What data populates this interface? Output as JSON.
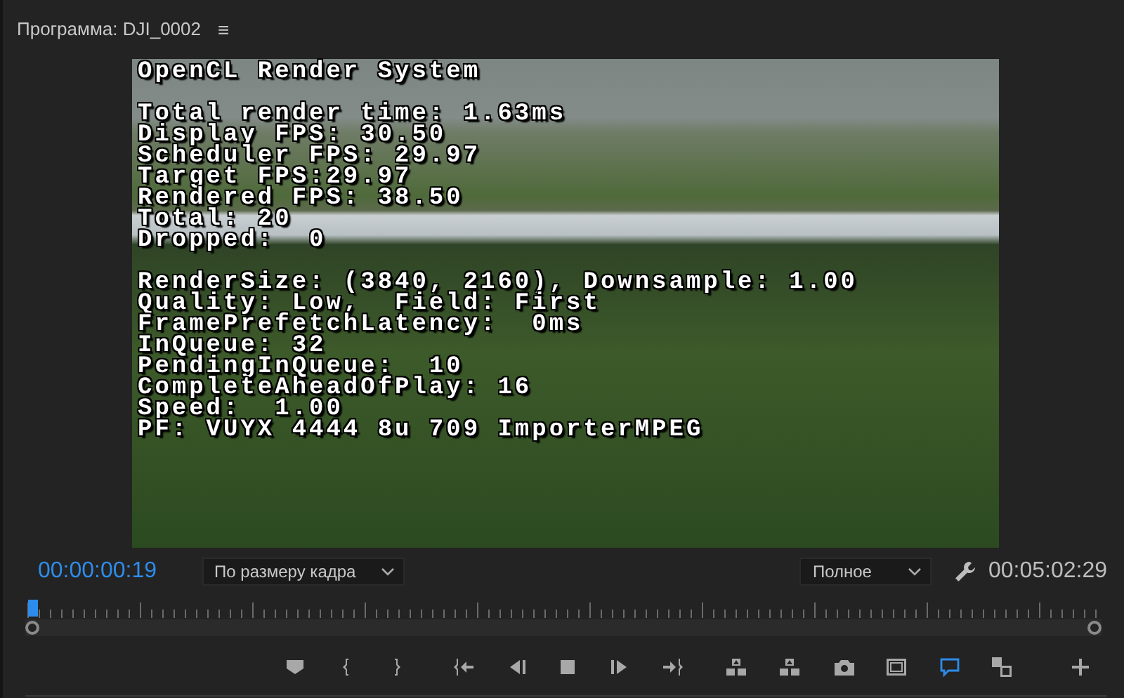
{
  "panel": {
    "title": "Программа: DJI_0002",
    "menu_glyph": "≡"
  },
  "overlay": {
    "groups": [
      [
        "OpenCL Render System"
      ],
      [
        "Total render time: 1.63ms",
        "Display FPS: 30.50",
        "Scheduler FPS: 29.97",
        "Target FPS:29.97",
        "Rendered FPS: 38.50",
        "Total: 20",
        "Dropped:  0"
      ],
      [
        "RenderSize: (3840, 2160), Downsample: 1.00",
        "Quality: Low,  Field: First",
        "FramePrefetchLatency:  0ms",
        "InQueue: 32",
        "PendingInQueue:  10",
        "CompleteAheadOfPlay: 16",
        "Speed:  1.00",
        "PF: VUYX 4444 8u 709 ImporterMPEG"
      ]
    ]
  },
  "current_time": "00:00:00:19",
  "zoom_select": {
    "value": "По размеру кадра"
  },
  "quality_select": {
    "value": "Полное"
  },
  "duration": "00:05:02:29",
  "playhead": {
    "level": 0.002
  },
  "buttons": [
    {
      "kind": "marker",
      "selected": false
    },
    {
      "kind": "mark-in",
      "selected": false
    },
    {
      "kind": "mark-out",
      "selected": false
    },
    {
      "kind": "go-in",
      "selected": false
    },
    {
      "kind": "step-back",
      "selected": false
    },
    {
      "kind": "stop",
      "selected": false
    },
    {
      "kind": "step-forward",
      "selected": false
    },
    {
      "kind": "go-out",
      "selected": false
    },
    {
      "kind": "lift",
      "selected": false
    },
    {
      "kind": "extract",
      "selected": false
    },
    {
      "kind": "camera",
      "selected": false
    },
    {
      "kind": "safe-margins",
      "selected": false
    },
    {
      "kind": "comment",
      "selected": true
    },
    {
      "kind": "compare",
      "selected": false
    },
    {
      "kind": "add",
      "selected": false
    }
  ]
}
